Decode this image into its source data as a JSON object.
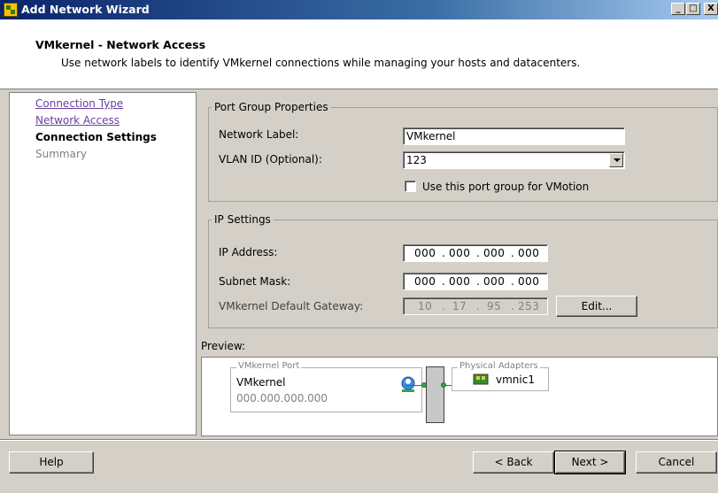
{
  "window": {
    "title": "Add Network Wizard",
    "controls": {
      "minimize": "_",
      "maximize": "□",
      "close": "X"
    }
  },
  "header": {
    "title": "VMkernel - Network Access",
    "description": "Use network labels to identify VMkernel connections while managing your hosts and datacenters."
  },
  "nav": {
    "items": [
      {
        "label": "Connection Type",
        "state": "link"
      },
      {
        "label": "Network Access",
        "state": "link"
      },
      {
        "label": "Connection Settings",
        "state": "current"
      },
      {
        "label": "Summary",
        "state": "disabled"
      }
    ]
  },
  "port_group": {
    "legend": "Port Group Properties",
    "network_label": {
      "label": "Network Label:",
      "value": "VMkernel"
    },
    "vlan": {
      "label": "VLAN ID (Optional):",
      "value": "123"
    },
    "vmotion": {
      "label": "Use this port group for VMotion",
      "checked": false
    }
  },
  "ip_settings": {
    "legend": "IP Settings",
    "ip_address": {
      "label": "IP Address:",
      "octets": [
        "000",
        "000",
        "000",
        "000"
      ]
    },
    "subnet_mask": {
      "label": "Subnet Mask:",
      "octets": [
        "000",
        "000",
        "000",
        "000"
      ]
    },
    "gateway": {
      "label": "VMkernel Default Gateway:",
      "octets": [
        "10",
        "17",
        "95",
        "253"
      ]
    },
    "edit_button": "Edit..."
  },
  "preview": {
    "label": "Preview:",
    "vmkernel_port": {
      "caption": "VMkernel Port",
      "name": "VMkernel",
      "ip": "000.000.000.000"
    },
    "physical_adapters": {
      "caption": "Physical Adapters",
      "adapter": "vmnic1"
    }
  },
  "footer": {
    "help": "Help",
    "back": "< Back",
    "next": "Next >",
    "cancel": "Cancel"
  },
  "colors": {
    "title_bar": "#0a246a",
    "link": "#6b3fa0",
    "window_bg": "#d4d0c8",
    "connector_green": "#2fa84f"
  }
}
